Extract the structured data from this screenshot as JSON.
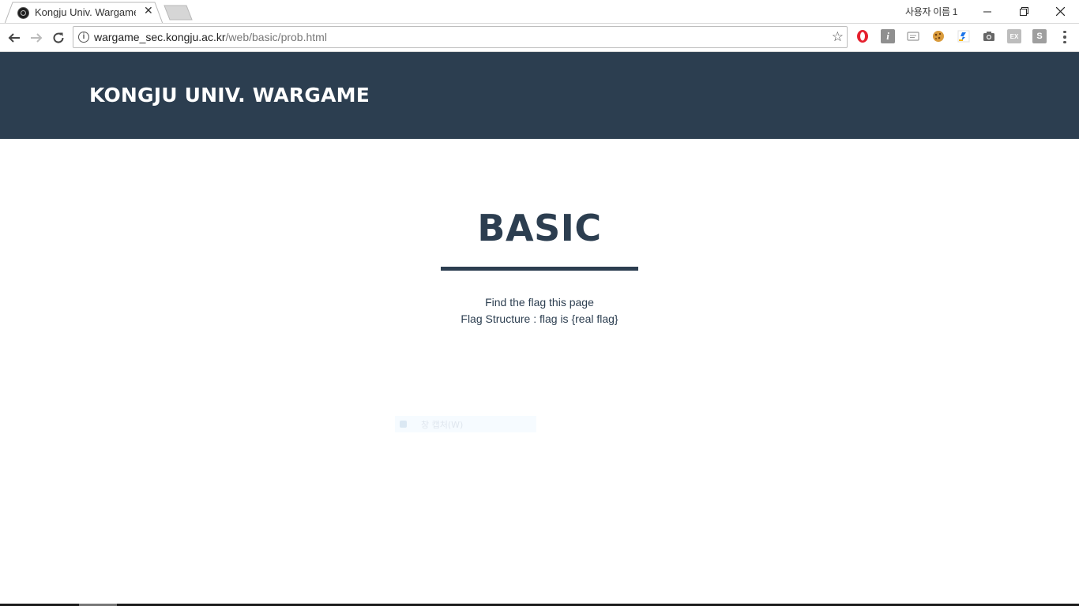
{
  "browser": {
    "tab_title": "Kongju Univ. Wargame",
    "tab_close": "✕",
    "profile_name": "사용자 이름 1",
    "url_host": "wargame_sec.kongju.ac.kr",
    "url_path": "/web/basic/prob.html",
    "star_icon": "☆",
    "info_icon": "i",
    "extensions": [
      {
        "name": "opera-icon"
      },
      {
        "name": "info-extension-icon",
        "label": "i"
      },
      {
        "name": "reader-icon"
      },
      {
        "name": "cookie-icon"
      },
      {
        "name": "extension-icon"
      },
      {
        "name": "camera-icon"
      },
      {
        "name": "ex-extension-icon",
        "label": "EX"
      },
      {
        "name": "s-extension-icon",
        "label": "S"
      }
    ]
  },
  "site": {
    "brand": "KONGJU UNIV. WARGAME",
    "heading": "BASIC",
    "description": [
      "Find the flag this page",
      "Flag Structure : flag is {real flag}"
    ],
    "ghost_menu_label": "창 캡처(W)"
  },
  "colors": {
    "header_bg": "#2c3e50",
    "text_primary": "#2c3e50",
    "white": "#ffffff"
  }
}
